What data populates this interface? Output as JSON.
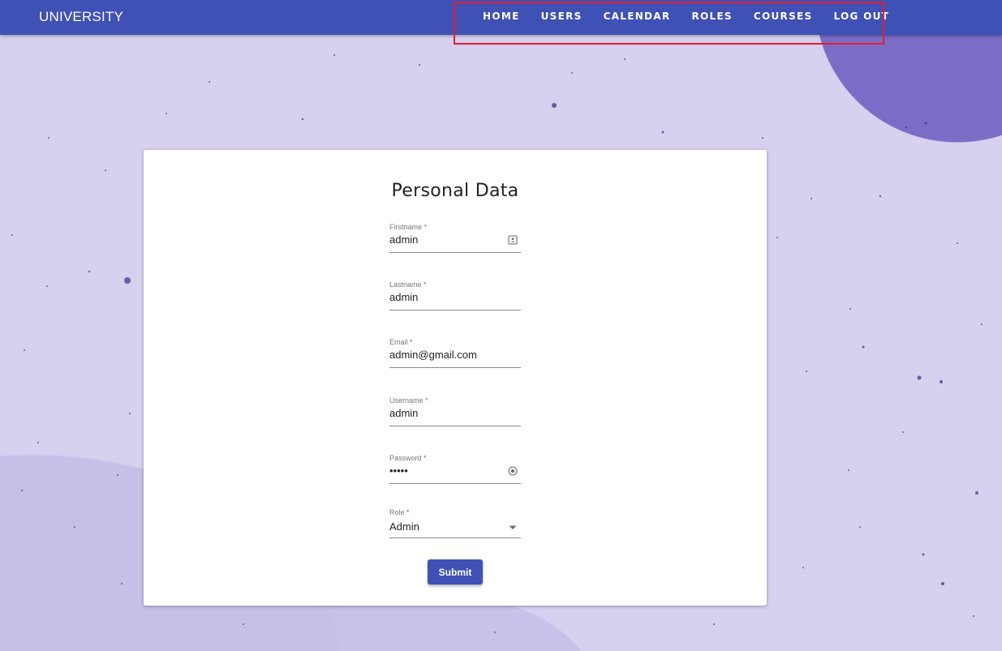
{
  "header": {
    "brand": "UNIVERSITY",
    "nav": [
      {
        "label": "HOME"
      },
      {
        "label": "USERS"
      },
      {
        "label": "CALENDAR"
      },
      {
        "label": "ROLES"
      },
      {
        "label": "COURSES"
      },
      {
        "label": "LOG OUT"
      }
    ]
  },
  "form": {
    "title": "Personal Data",
    "fields": {
      "firstname": {
        "label": "Firstname *",
        "value": "admin",
        "icon": "contact-card-icon"
      },
      "lastname": {
        "label": "Lastname *",
        "value": "admin"
      },
      "email": {
        "label": "Email *",
        "value": "admin@gmail.com"
      },
      "username": {
        "label": "Username *",
        "value": "admin"
      },
      "password": {
        "label": "Password *",
        "value": "admin",
        "icon": "password-reveal-icon"
      },
      "role": {
        "label": "Role *",
        "value": "Admin",
        "icon": "dropdown-arrow-icon"
      }
    },
    "submit_label": "Submit"
  },
  "colors": {
    "primary": "#3f51b5",
    "background": "#d7d0ef",
    "highlight_border": "#e0202f"
  }
}
